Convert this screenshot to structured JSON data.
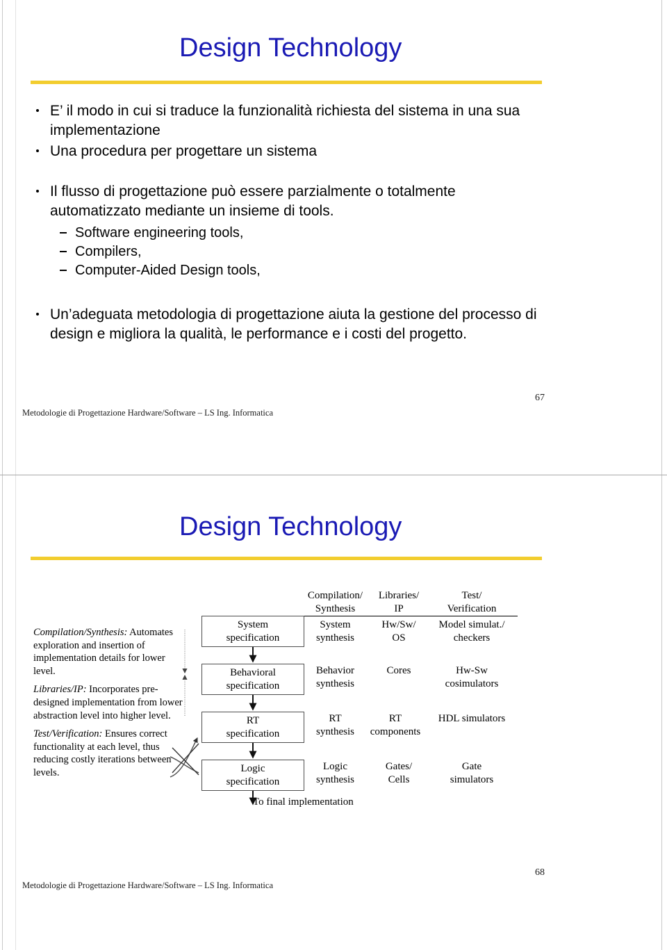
{
  "slide1": {
    "title": "Design Technology",
    "bullets": [
      "E’ il modo in cui si traduce la funzionalità richiesta del sistema in una sua implementazione",
      "Una procedura per progettare un sistema",
      "Il flusso di progettazione può essere parzialmente o totalmente automatizzato mediante un insieme di tools."
    ],
    "sub_bullets": [
      "Software engineering tools,",
      "Compilers,",
      "Computer-Aided Design tools,"
    ],
    "last_bullet": "Un’adeguata metodologia di progettazione aiuta la gestione del processo di design e migliora la qualità, le performance e i costi  del progetto.",
    "footer": "Metodologie di Progettazione Hardware/Software – LS Ing. Informatica",
    "page_number": "67"
  },
  "slide2": {
    "title": "Design Technology",
    "footer": "Metodologie di Progettazione Hardware/Software – LS Ing. Informatica",
    "page_number": "68",
    "notes": [
      {
        "lead": "Compilation/Synthesis:",
        "text": " Automates exploration and insertion of implementation details for lower level."
      },
      {
        "lead": "Libraries/IP:",
        "text": " Incorporates pre-designed implementation from lower abstraction level into higher level."
      },
      {
        "lead": "Test/Verification:",
        "text": " Ensures correct functionality at each level, thus reducing costly iterations between levels."
      }
    ],
    "spec_boxes": [
      {
        "line1": "System",
        "line2": "specification"
      },
      {
        "line1": "Behavioral",
        "line2": "specification"
      },
      {
        "line1": "RT",
        "line2": "specification"
      },
      {
        "line1": "Logic",
        "line2": "specification"
      }
    ],
    "final_label": "To final implementation",
    "columns": [
      {
        "head_line1": "Compilation/",
        "head_line2": "Synthesis"
      },
      {
        "head_line1": "Libraries/",
        "head_line2": "IP"
      },
      {
        "head_line1": "Test/",
        "head_line2": "Verification"
      }
    ],
    "rows": [
      {
        "compilation_line1": "System",
        "compilation_line2": "synthesis",
        "libraries_line1": "Hw/Sw/",
        "libraries_line2": "OS",
        "test_line1": "Model simulat./",
        "test_line2": "checkers"
      },
      {
        "compilation_line1": "Behavior",
        "compilation_line2": "synthesis",
        "libraries_line1": "Cores",
        "libraries_line2": "",
        "test_line1": "Hw-Sw",
        "test_line2": "cosimulators"
      },
      {
        "compilation_line1": "RT",
        "compilation_line2": "synthesis",
        "libraries_line1": "RT",
        "libraries_line2": "components",
        "test_line1": "HDL simulators",
        "test_line2": ""
      },
      {
        "compilation_line1": "Logic",
        "compilation_line2": "synthesis",
        "libraries_line1": "Gates/",
        "libraries_line2": "Cells",
        "test_line1": "Gate",
        "test_line2": "simulators"
      }
    ]
  },
  "colors": {
    "title_blue": "#1a1ab4",
    "rule_yellow": "#f2cd2e",
    "box_border": "#4d4d4d",
    "separator": "#a8a8a8"
  }
}
